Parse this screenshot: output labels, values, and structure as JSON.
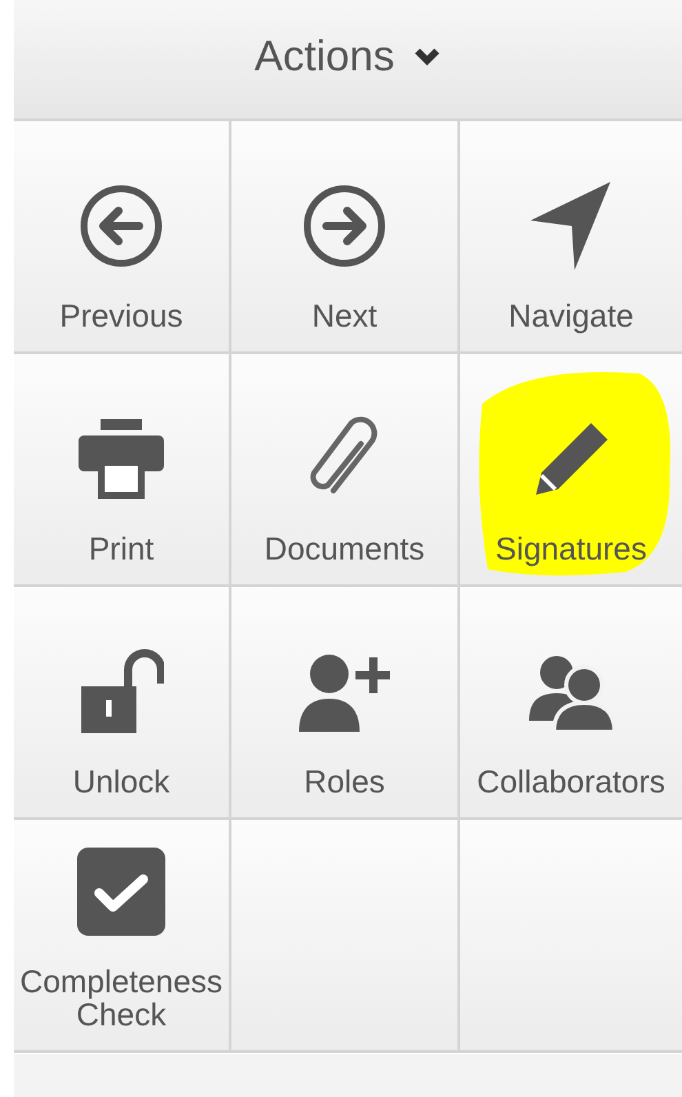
{
  "header": {
    "title": "Actions",
    "expanded": false
  },
  "actions": [
    {
      "label": "Previous",
      "kind": "previous",
      "highlighted": false
    },
    {
      "label": "Next",
      "kind": "next",
      "highlighted": false
    },
    {
      "label": "Navigate",
      "kind": "navigate",
      "highlighted": false
    },
    {
      "label": "Print",
      "kind": "print",
      "highlighted": false
    },
    {
      "label": "Documents",
      "kind": "documents",
      "highlighted": false
    },
    {
      "label": "Signatures",
      "kind": "signatures",
      "highlighted": true
    },
    {
      "label": "Unlock",
      "kind": "unlock",
      "highlighted": false
    },
    {
      "label": "Roles",
      "kind": "roles",
      "highlighted": false
    },
    {
      "label": "Collaborators",
      "kind": "collaborators",
      "highlighted": false
    },
    {
      "label": "Completeness Check",
      "kind": "check",
      "highlighted": false
    }
  ]
}
